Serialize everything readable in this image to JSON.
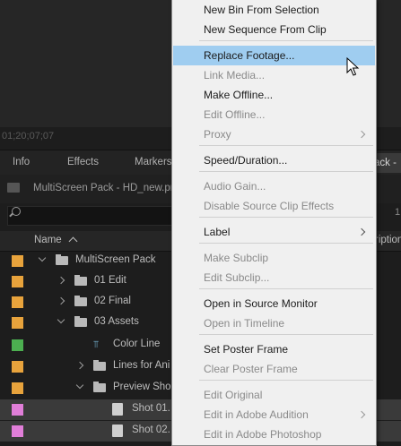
{
  "monitor": {
    "timecode": "01;20;07;07"
  },
  "panel_tabs": [
    "Info",
    "Effects",
    "Markers"
  ],
  "active_tab_fragment": "ack -",
  "project": {
    "name": "MultiScreen Pack - HD_new.prp"
  },
  "side_number": "1",
  "columns": {
    "name": "Name",
    "right": "ription"
  },
  "rows": [
    {
      "label": "MultiScreen Pack",
      "color": "#e8a33c",
      "type": "folder",
      "expand": "open"
    },
    {
      "label": "01 Edit",
      "color": "#e8a33c",
      "type": "folder",
      "expand": "closed"
    },
    {
      "label": "02 Final",
      "color": "#e8a33c",
      "type": "folder",
      "expand": "closed"
    },
    {
      "label": "03 Assets",
      "color": "#e8a33c",
      "type": "folder",
      "expand": "open"
    },
    {
      "label": "Color Line",
      "color": "#4caf50",
      "type": "sequence",
      "expand": ""
    },
    {
      "label": "Lines for Ani",
      "color": "#e8a33c",
      "type": "folder",
      "expand": "closed"
    },
    {
      "label": "Preview Sho",
      "color": "#e8a33c",
      "type": "folder",
      "expand": "open"
    },
    {
      "label": "Shot 01.",
      "color": "#e07ed8",
      "type": "clip",
      "expand": ""
    },
    {
      "label": "Shot 02.",
      "color": "#e07ed8",
      "type": "clip",
      "expand": ""
    }
  ],
  "context_menu": {
    "items": [
      {
        "label": "New Bin From Selection",
        "disabled": false
      },
      {
        "label": "New Sequence From Clip",
        "disabled": false
      },
      {
        "label": "Replace Footage...",
        "disabled": false,
        "highlight": true
      },
      {
        "label": "Link Media...",
        "disabled": true
      },
      {
        "label": "Make Offline...",
        "disabled": false
      },
      {
        "label": "Edit Offline...",
        "disabled": true
      },
      {
        "label": "Proxy",
        "disabled": true,
        "submenu": true
      },
      {
        "label": "Speed/Duration...",
        "disabled": false
      },
      {
        "label": "Audio Gain...",
        "disabled": true
      },
      {
        "label": "Disable Source Clip Effects",
        "disabled": true
      },
      {
        "label": "Label",
        "disabled": false,
        "submenu": true
      },
      {
        "label": "Make Subclip",
        "disabled": true
      },
      {
        "label": "Edit Subclip...",
        "disabled": true
      },
      {
        "label": "Open in Source Monitor",
        "disabled": false
      },
      {
        "label": "Open in Timeline",
        "disabled": true
      },
      {
        "label": "Set Poster Frame",
        "disabled": false
      },
      {
        "label": "Clear Poster Frame",
        "disabled": true
      },
      {
        "label": "Edit Original",
        "disabled": true
      },
      {
        "label": "Edit in Adobe Audition",
        "disabled": true,
        "submenu": true
      },
      {
        "label": "Edit in Adobe Photoshop",
        "disabled": true
      }
    ]
  }
}
